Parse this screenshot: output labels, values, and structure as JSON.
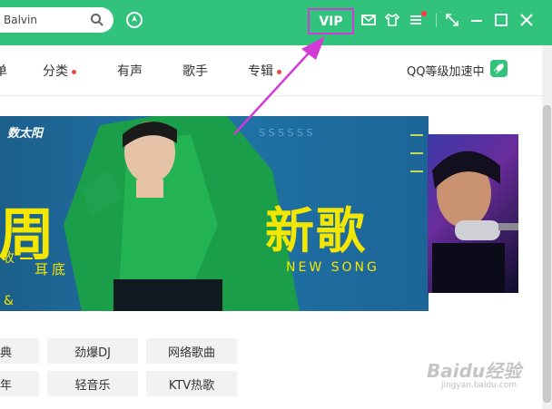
{
  "search": {
    "value": "Balvin"
  },
  "topbar": {
    "vip_label": "VIP"
  },
  "nav": {
    "items": [
      {
        "label": "单",
        "dot": false
      },
      {
        "label": "分类",
        "dot": true
      },
      {
        "label": "有声",
        "dot": false
      },
      {
        "label": "歌手",
        "dot": false
      },
      {
        "label": "专辑",
        "dot": true
      }
    ],
    "accelerate_label": "QQ等级加速中"
  },
  "banner": {
    "logo_text": "数太阳",
    "big_left": "周",
    "big_right": "新歌",
    "small_left": "收",
    "subtitle_cn": "耳底",
    "subtitle_en": "NEW SONG",
    "amp": "&"
  },
  "categories": [
    [
      "典",
      "劲爆DJ",
      "网络歌曲"
    ],
    [
      "年",
      "轻音乐",
      "KTV热歌"
    ]
  ],
  "watermark": {
    "brand": "Baidu经验",
    "url": "jingyan.baidu.com"
  },
  "colors": {
    "accent": "#31c27c",
    "vip_highlight": "#d33bd6",
    "badge_red": "#f0483e",
    "banner_text": "#f3e600"
  }
}
